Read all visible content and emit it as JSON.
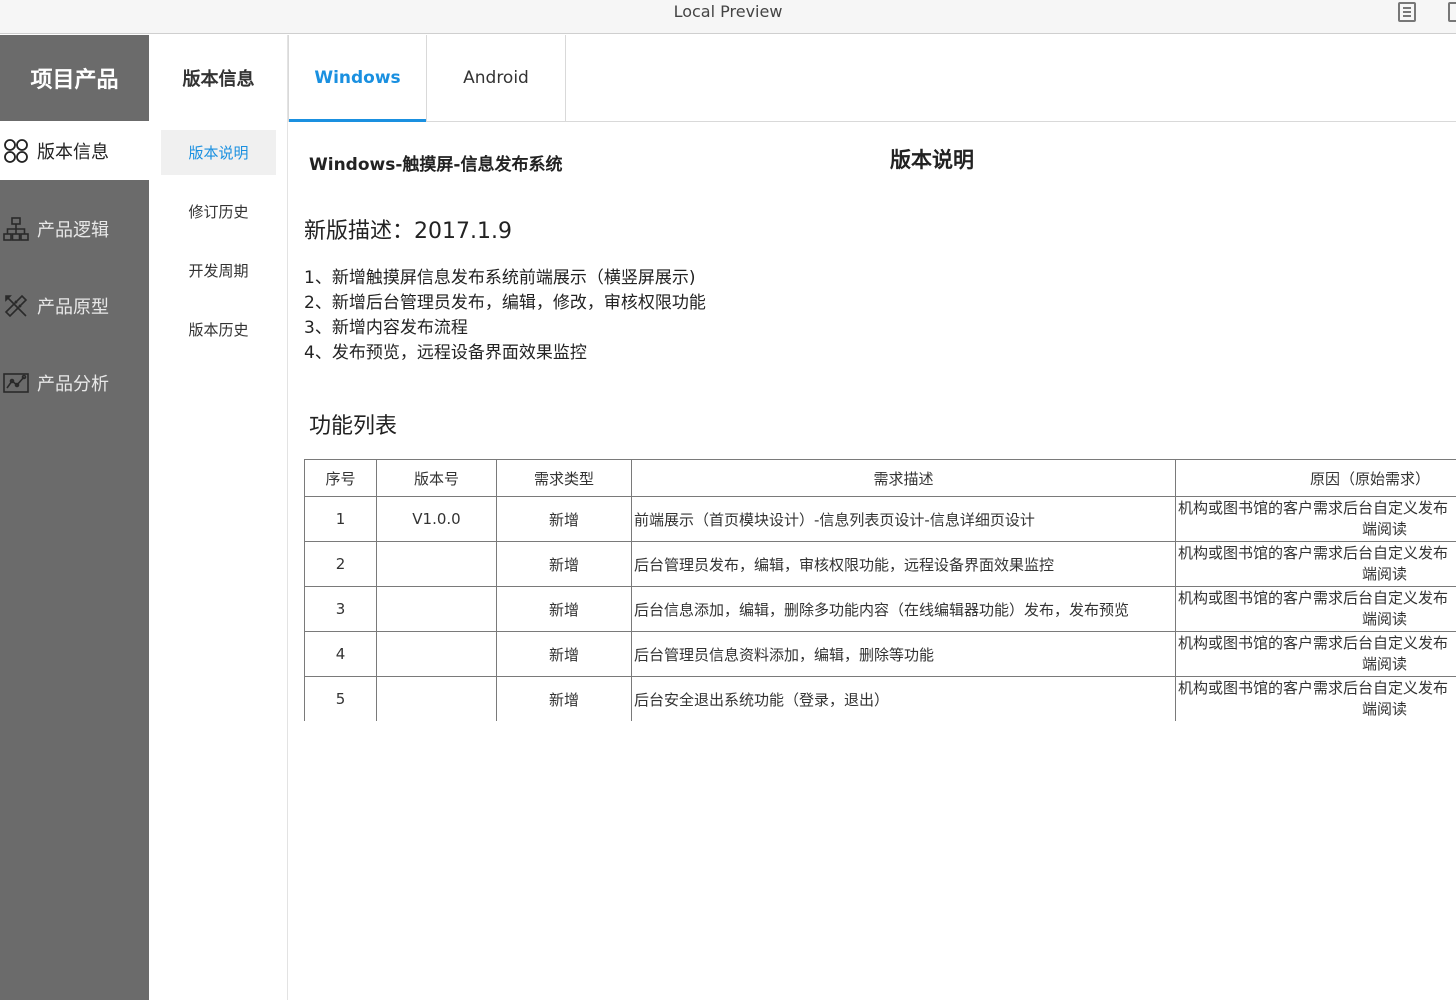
{
  "window": {
    "title": "Local Preview"
  },
  "sidebar": {
    "brand": "项目产品",
    "items": [
      {
        "label": "版本信息",
        "icon": "grid-circles-icon"
      },
      {
        "label": "产品逻辑",
        "icon": "org-chart-icon"
      },
      {
        "label": "产品原型",
        "icon": "design-tools-icon"
      },
      {
        "label": "产品分析",
        "icon": "analytics-chart-icon"
      }
    ]
  },
  "subnav": {
    "title": "版本信息",
    "items": [
      {
        "label": "版本说明"
      },
      {
        "label": "修订历史"
      },
      {
        "label": "开发周期"
      },
      {
        "label": "版本历史"
      }
    ]
  },
  "tabs": [
    {
      "label": "Windows"
    },
    {
      "label": "Android"
    }
  ],
  "doc": {
    "subtitle": "Windows-触摸屏-信息发布系统",
    "title": "版本说明",
    "desc_heading": "新版描述：2017.1.9",
    "desc_items": [
      "1、新增触摸屏信息发布系统前端展示（横竖屏展示)",
      "2、新增后台管理员发布，编辑，修改，审核权限功能",
      "3、新增内容发布流程",
      "4、发布预览，远程设备界面效果监控"
    ],
    "features_heading": "功能列表"
  },
  "table": {
    "headers": [
      "序号",
      "版本号",
      "需求类型",
      "需求描述",
      "原因（原始需求）"
    ],
    "rows": [
      {
        "no": "1",
        "version": "V1.0.0",
        "type": "新增",
        "desc": "前端展示（首页模块设计）-信息列表页设计-信息详细页设计",
        "reason_line1": "机构或图书馆的客户需求后台自定义发布",
        "reason_line2": "端阅读"
      },
      {
        "no": "2",
        "version": "",
        "type": "新增",
        "desc": "后台管理员发布，编辑，审核权限功能，远程设备界面效果监控",
        "reason_line1": "机构或图书馆的客户需求后台自定义发布",
        "reason_line2": "端阅读"
      },
      {
        "no": "3",
        "version": "",
        "type": "新增",
        "desc": "后台信息添加，编辑，删除多功能内容（在线编辑器功能）发布，发布预览",
        "reason_line1": "机构或图书馆的客户需求后台自定义发布",
        "reason_line2": "端阅读"
      },
      {
        "no": "4",
        "version": "",
        "type": "新增",
        "desc": "后台管理员信息资料添加，编辑，删除等功能",
        "reason_line1": "机构或图书馆的客户需求后台自定义发布",
        "reason_line2": "端阅读"
      },
      {
        "no": "5",
        "version": "",
        "type": "新增",
        "desc": "后台安全退出系统功能（登录，退出）",
        "reason_line1": "机构或图书馆的客户需求后台自定义发布",
        "reason_line2": "端阅读"
      }
    ]
  },
  "colors": {
    "accent": "#1a90e0",
    "sidebar_bg": "#6b6b6b"
  }
}
